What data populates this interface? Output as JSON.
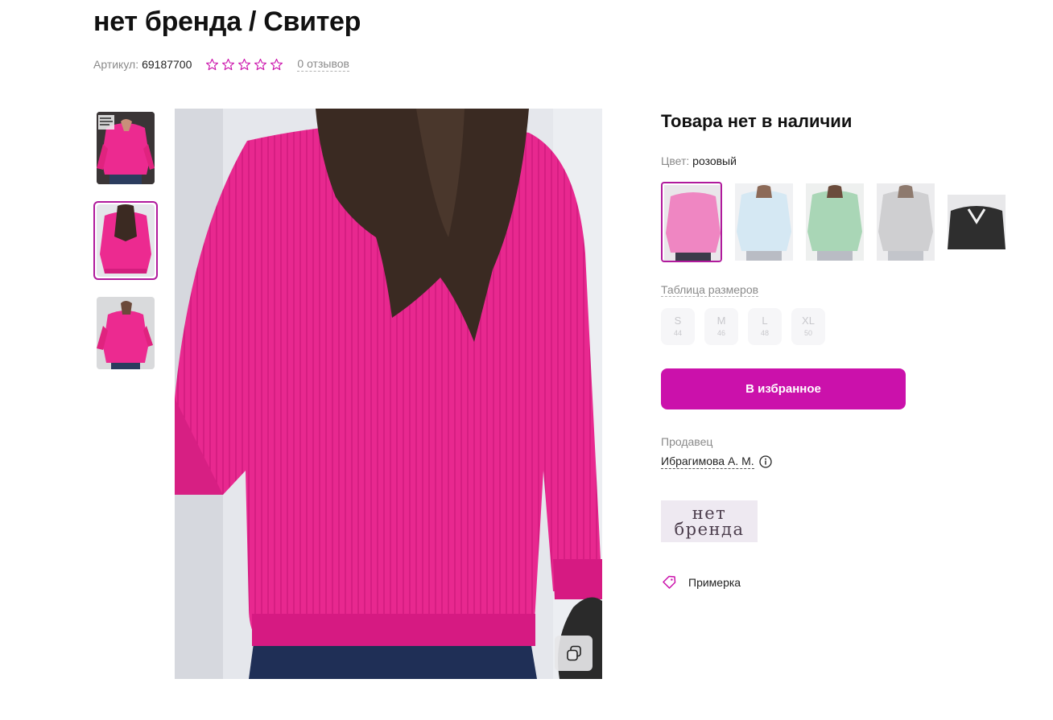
{
  "product": {
    "title": "нет бренда / Свитер",
    "article_label": "Артикул:",
    "article_value": "69187700",
    "rating_stars": 0,
    "rating_max": 5,
    "reviews_label": "0 отзывов"
  },
  "gallery": {
    "thumbnails_count": 3,
    "active_thumbnail": 1
  },
  "availability": {
    "status": "Товара нет в наличии"
  },
  "color": {
    "label": "Цвет:",
    "value": "розовый",
    "swatches": [
      {
        "name": "pink",
        "color": "#ef7fbf",
        "selected": true
      },
      {
        "name": "light-blue",
        "color": "#d3e6f2",
        "selected": false
      },
      {
        "name": "mint",
        "color": "#a9d8b9",
        "selected": false
      },
      {
        "name": "grey",
        "color": "#cfcfcf",
        "selected": false
      },
      {
        "name": "black",
        "color": "#2b2b2b",
        "selected": false
      }
    ]
  },
  "sizes": {
    "table_label": "Таблица размеров",
    "items": [
      {
        "size": "S",
        "ru": "44"
      },
      {
        "size": "M",
        "ru": "46"
      },
      {
        "size": "L",
        "ru": "48"
      },
      {
        "size": "XL",
        "ru": "50"
      }
    ]
  },
  "actions": {
    "favorite_label": "В избранное"
  },
  "seller": {
    "label": "Продавец",
    "name": "Ибрагимова А. М."
  },
  "brand": {
    "logo_line1": "нет",
    "logo_line2": "бренда"
  },
  "fitting": {
    "label": "Примерка"
  },
  "colors": {
    "accent": "#cb11ab",
    "accent_border": "#b01a9c",
    "sweater": "#e8288f",
    "muted_text": "#8a8a8a"
  }
}
